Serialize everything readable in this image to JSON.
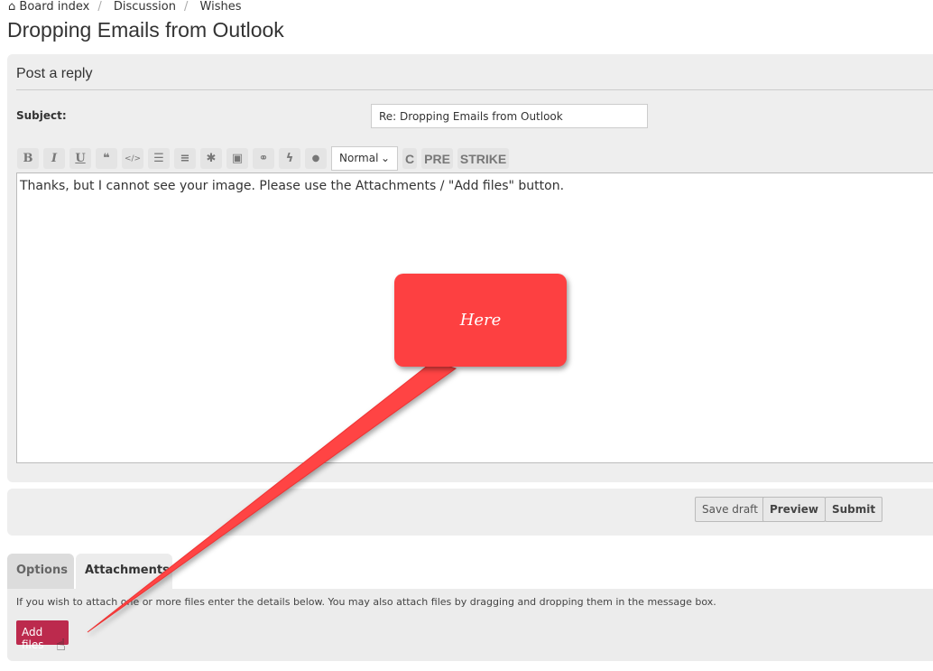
{
  "breadcrumb": [
    "Board index",
    "Discussion",
    "Wishes"
  ],
  "page_title": "Dropping Emails from Outlook",
  "reply": {
    "title": "Post a reply",
    "subject_label": "Subject:",
    "subject_value": "Re: Dropping Emails from Outlook",
    "toolbar": [
      "B",
      "I",
      "U",
      "❝",
      "</>",
      "☰",
      "≡",
      "✱",
      "▣",
      "⚭",
      "ϟ",
      "●"
    ],
    "font_size": "Normal",
    "extra": [
      "C",
      "PRE",
      "STRIKE"
    ],
    "message": "Thanks, but I cannot see your image. Please use the Attachments / \"Add files\" button."
  },
  "actions": {
    "save_draft": "Save draft",
    "preview": "Preview",
    "submit": "Submit"
  },
  "tabs": {
    "options": "Options",
    "attachments": "Attachments"
  },
  "attachments": {
    "hint": "If you wish to attach one or more files enter the details below. You may also attach files by dragging and dropping them in the message box.",
    "add_files": "Add files"
  },
  "annotation": {
    "text": "Here",
    "color": "#fd4041"
  }
}
